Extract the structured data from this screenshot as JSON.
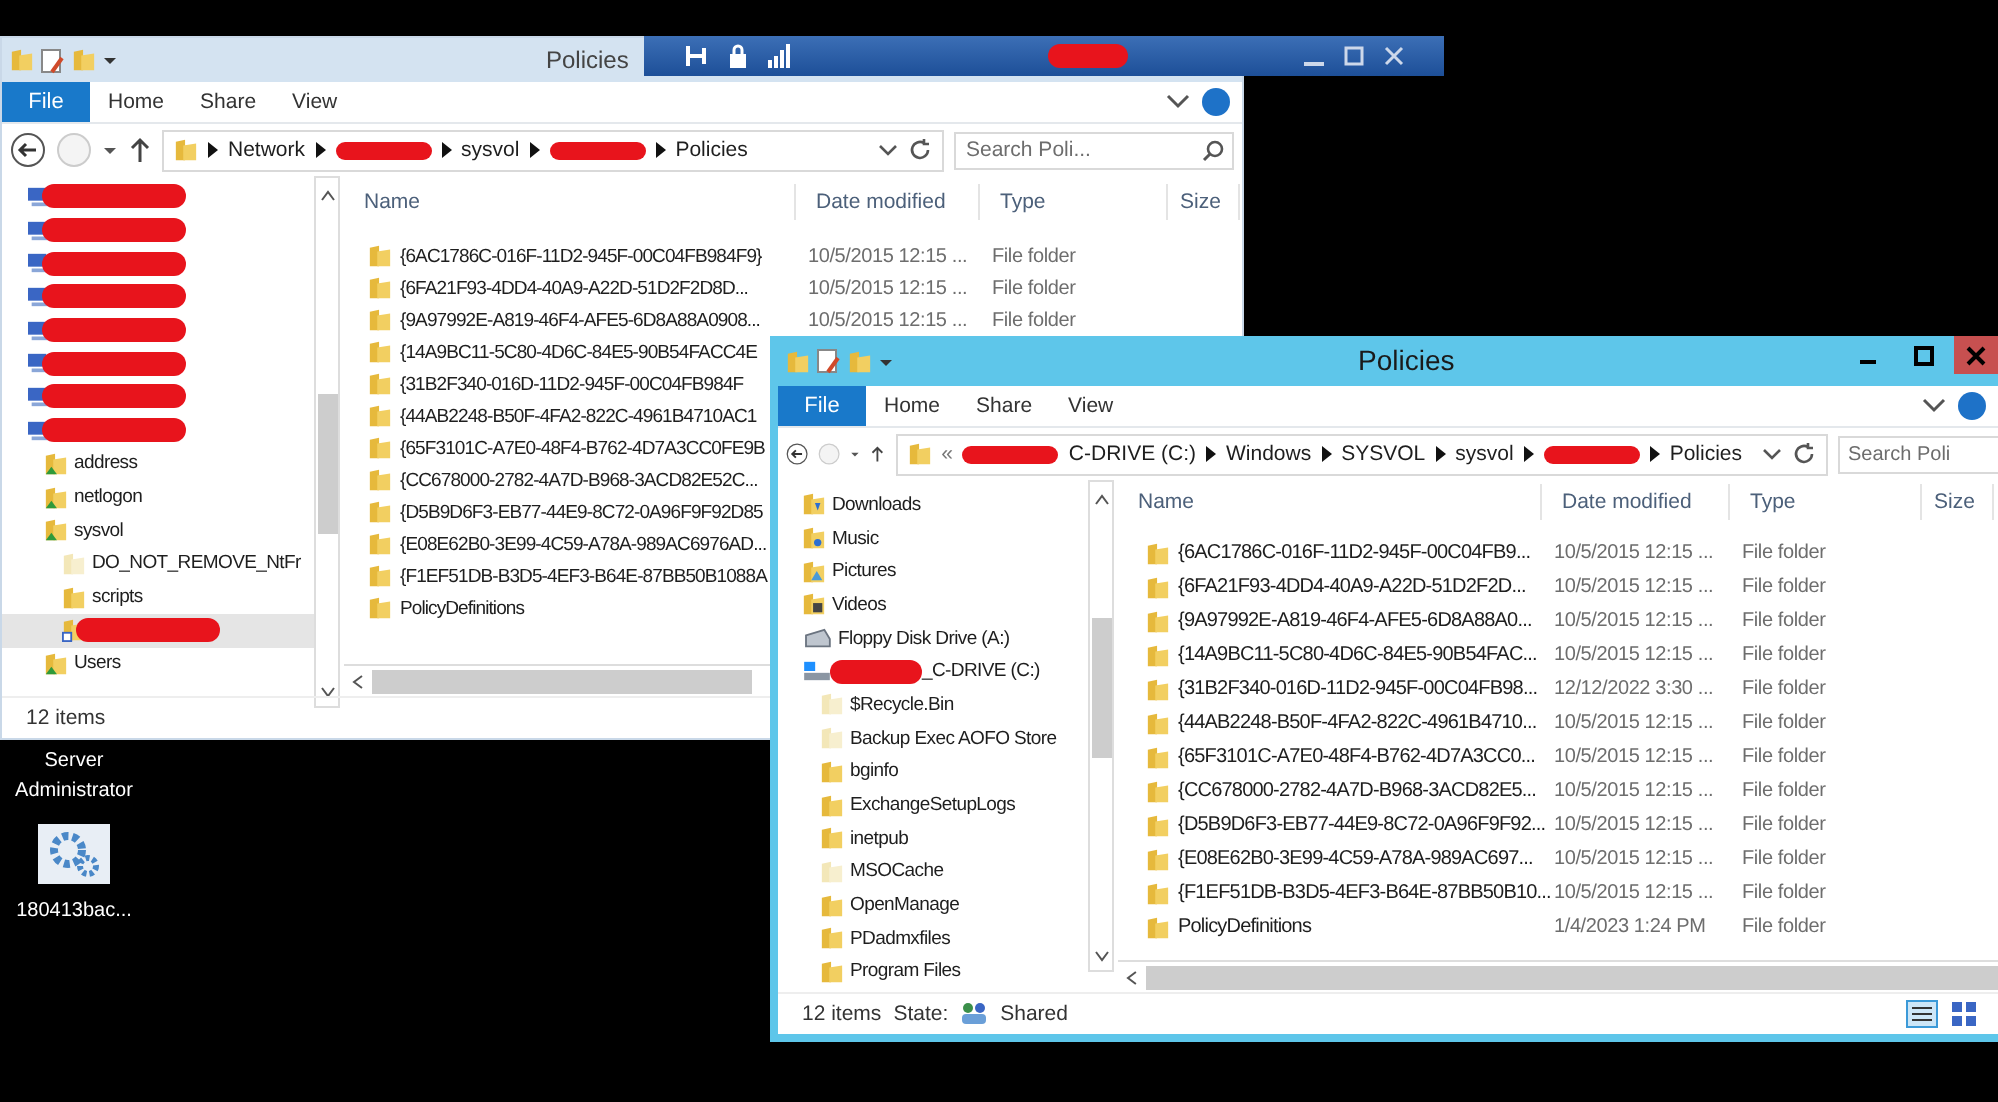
{
  "desktop_icons": [
    {
      "label": "Server Administrator",
      "kind": "label"
    },
    {
      "label": "180413bac...",
      "kind": "shortcut"
    }
  ],
  "windows": [
    {
      "title": "Policies",
      "active": false,
      "ribbon_tabs": [
        {
          "label": "File",
          "kind": "file"
        },
        {
          "label": "Home",
          "kind": "tab"
        },
        {
          "label": "Share",
          "kind": "tab"
        },
        {
          "label": "View",
          "kind": "tab"
        }
      ],
      "address": {
        "segments": [
          {
            "label": "Network",
            "kind": "text"
          },
          {
            "kind": "redacted"
          },
          {
            "label": "sysvol",
            "kind": "text"
          },
          {
            "kind": "redacted"
          },
          {
            "label": "Policies",
            "kind": "text"
          }
        ]
      },
      "search": {
        "placeholder": "Search Poli..."
      },
      "nav": [
        {
          "kind": "computer",
          "selected": false
        },
        {
          "kind": "computer",
          "selected": false
        },
        {
          "kind": "computer",
          "selected": false
        },
        {
          "kind": "computer",
          "selected": false
        },
        {
          "kind": "computer",
          "selected": false
        },
        {
          "kind": "computer",
          "selected": false
        },
        {
          "kind": "computer",
          "selected": false
        },
        {
          "kind": "computer",
          "selected": false,
          "children": [
            {
              "label": "address",
              "kind": "shared-folder",
              "selected": false
            },
            {
              "label": "netlogon",
              "kind": "shared-folder",
              "selected": false
            },
            {
              "label": "sysvol",
              "kind": "shared-folder",
              "selected": false,
              "children": [
                {
                  "label": "DO_NOT_REMOVE_NtFr",
                  "kind": "hidden-folder",
                  "selected": false
                },
                {
                  "label": "scripts",
                  "kind": "folder",
                  "selected": false
                },
                {
                  "kind": "shortcut-folder",
                  "selected": true
                }
              ]
            },
            {
              "label": "Users",
              "kind": "shared-folder",
              "selected": false
            }
          ]
        }
      ],
      "columns": [
        "Name",
        "Date modified",
        "Type",
        "Size"
      ],
      "rows": [
        {
          "name": "{6AC1786C-016F-11D2-945F-00C04FB984F9}",
          "date": "10/5/2015 12:15 ...",
          "type": "File folder"
        },
        {
          "name": "{6FA21F93-4DD4-40A9-A22D-51D2F2D8D...",
          "date": "10/5/2015 12:15 ...",
          "type": "File folder"
        },
        {
          "name": "{9A97992E-A819-46F4-AFE5-6D8A88A0908...",
          "date": "10/5/2015 12:15 ...",
          "type": "File folder"
        },
        {
          "name": "{14A9BC11-5C80-4D6C-84E5-90B54FACC4E"
        },
        {
          "name": "{31B2F340-016D-11D2-945F-00C04FB984F"
        },
        {
          "name": "{44AB2248-B50F-4FA2-822C-4961B4710AC1"
        },
        {
          "name": "{65F3101C-A7E0-48F4-B762-4D7A3CC0FE9B"
        },
        {
          "name": "{CC678000-2782-4A7D-B968-3ACD82E52C..."
        },
        {
          "name": "{D5B9D6F3-EB77-44E9-8C72-0A96F9F92D85"
        },
        {
          "name": "{E08E62B0-3E99-4C59-A78A-989AC6976AD..."
        },
        {
          "name": "{F1EF51DB-B3D5-4EF3-B64E-87BB50B1088A"
        },
        {
          "name": "PolicyDefinitions"
        }
      ],
      "status": {
        "count": "12 items"
      }
    },
    {
      "title": "Policies",
      "active": true,
      "ribbon_tabs": [
        {
          "label": "File",
          "kind": "file"
        },
        {
          "label": "Home",
          "kind": "tab"
        },
        {
          "label": "Share",
          "kind": "tab"
        },
        {
          "label": "View",
          "kind": "tab"
        }
      ],
      "address": {
        "overflow": "«",
        "segments": [
          {
            "label": "C-DRIVE (C:)",
            "kind": "redacted-prefix"
          },
          {
            "label": "Windows",
            "kind": "text"
          },
          {
            "label": "SYSVOL",
            "kind": "text"
          },
          {
            "label": "sysvol",
            "kind": "text"
          },
          {
            "kind": "redacted"
          },
          {
            "label": "Policies",
            "kind": "text"
          }
        ]
      },
      "search": {
        "placeholder": "Search Poli"
      },
      "nav": [
        {
          "label": "Downloads",
          "kind": "downloads",
          "selected": false
        },
        {
          "label": "Music",
          "kind": "music",
          "selected": false
        },
        {
          "label": "Pictures",
          "kind": "pictures",
          "selected": false
        },
        {
          "label": "Videos",
          "kind": "videos",
          "selected": false
        },
        {
          "label": "Floppy Disk Drive (A:)",
          "kind": "floppy",
          "selected": false
        },
        {
          "label": "_C-DRIVE (C:)",
          "kind": "redacted-drive",
          "selected": false,
          "children": [
            {
              "label": "$Recycle.Bin",
              "kind": "hidden-folder",
              "selected": false
            },
            {
              "label": "Backup Exec AOFO Store",
              "kind": "hidden-folder",
              "selected": false
            },
            {
              "label": "bginfo",
              "kind": "folder",
              "selected": false
            },
            {
              "label": "ExchangeSetupLogs",
              "kind": "folder",
              "selected": false
            },
            {
              "label": "inetpub",
              "kind": "folder",
              "selected": false
            },
            {
              "label": "MSOCache",
              "kind": "hidden-folder",
              "selected": false
            },
            {
              "label": "OpenManage",
              "kind": "folder",
              "selected": false
            },
            {
              "label": "PDadmxfiles",
              "kind": "folder",
              "selected": false
            },
            {
              "label": "Program Files",
              "kind": "folder",
              "selected": false
            }
          ]
        }
      ],
      "columns": [
        "Name",
        "Date modified",
        "Type",
        "Size"
      ],
      "rows": [
        {
          "name": "{6AC1786C-016F-11D2-945F-00C04FB9...",
          "date": "10/5/2015 12:15 ...",
          "type": "File folder"
        },
        {
          "name": "{6FA21F93-4DD4-40A9-A22D-51D2F2D...",
          "date": "10/5/2015 12:15 ...",
          "type": "File folder"
        },
        {
          "name": "{9A97992E-A819-46F4-AFE5-6D8A88A0...",
          "date": "10/5/2015 12:15 ...",
          "type": "File folder"
        },
        {
          "name": "{14A9BC11-5C80-4D6C-84E5-90B54FAC...",
          "date": "10/5/2015 12:15 ...",
          "type": "File folder"
        },
        {
          "name": "{31B2F340-016D-11D2-945F-00C04FB98...",
          "date": "12/12/2022 3:30 ...",
          "type": "File folder"
        },
        {
          "name": "{44AB2248-B50F-4FA2-822C-4961B4710...",
          "date": "10/5/2015 12:15 ...",
          "type": "File folder"
        },
        {
          "name": "{65F3101C-A7E0-48F4-B762-4D7A3CC0...",
          "date": "10/5/2015 12:15 ...",
          "type": "File folder"
        },
        {
          "name": "{CC678000-2782-4A7D-B968-3ACD82E5...",
          "date": "10/5/2015 12:15 ...",
          "type": "File folder"
        },
        {
          "name": "{D5B9D6F3-EB77-44E9-8C72-0A96F9F92...",
          "date": "10/5/2015 12:15 ...",
          "type": "File folder"
        },
        {
          "name": "{E08E62B0-3E99-4C59-A78A-989AC697...",
          "date": "10/5/2015 12:15 ...",
          "type": "File folder"
        },
        {
          "name": "{F1EF51DB-B3D5-4EF3-B64E-87BB50B10...",
          "date": "10/5/2015 12:15 ...",
          "type": "File folder"
        },
        {
          "name": "PolicyDefinitions",
          "date": "1/4/2023 1:24 PM",
          "type": "File folder"
        }
      ],
      "status": {
        "count": "12 items",
        "state_label": "State:",
        "state_value": "Shared"
      }
    }
  ]
}
